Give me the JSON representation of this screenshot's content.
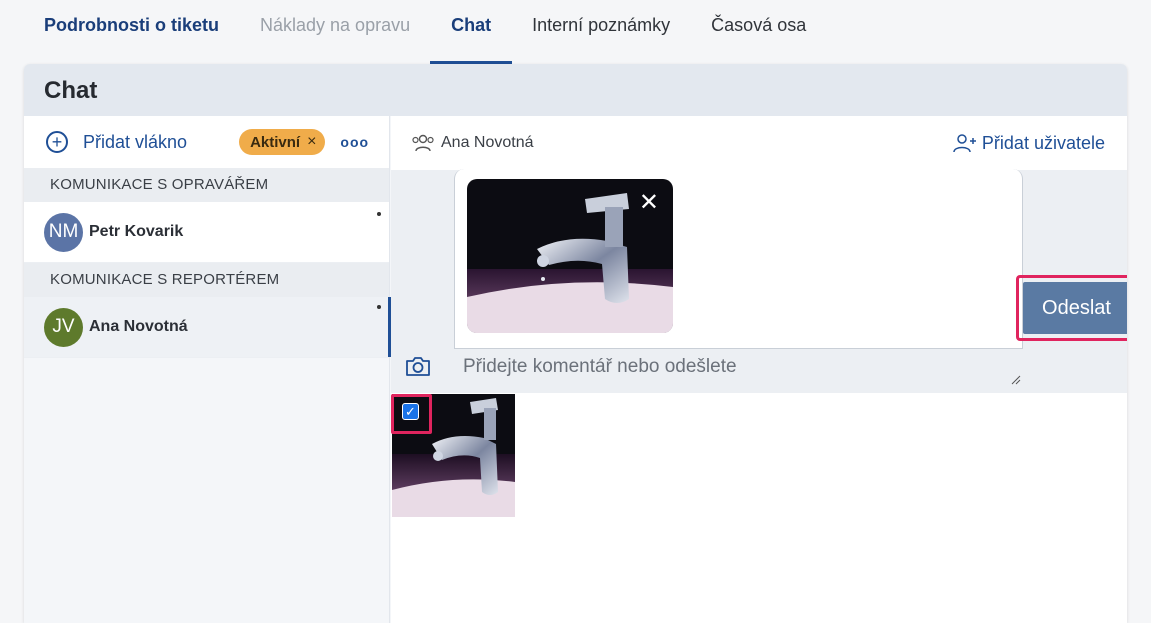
{
  "tabs": [
    {
      "label": "Podrobnosti o tiketu"
    },
    {
      "label": "Náklady na opravu"
    },
    {
      "label": "Chat"
    },
    {
      "label": "Interní poznámky"
    },
    {
      "label": "Časová osa"
    }
  ],
  "card": {
    "title": "Chat"
  },
  "left": {
    "add_thread_label": "Přidat vlákno",
    "plus_glyph": "+",
    "filter_badge": "Aktivní",
    "badge_close": "×",
    "more_glyph": "ooo",
    "groups": [
      {
        "title": "KOMUNIKACE S OPRAVÁŘEM",
        "threads": [
          {
            "initials": "NM",
            "name": "Petr Kovarik",
            "color": "#5b74a6"
          }
        ]
      },
      {
        "title": "KOMUNIKACE S REPORTÉREM",
        "threads": [
          {
            "initials": "JV",
            "name": "Ana Novotná",
            "color": "#5e7a2c"
          }
        ]
      }
    ]
  },
  "right": {
    "participants": "Ana Novotná",
    "add_user_label": "Přidat uživatele",
    "comment_placeholder": "Přidejte komentář nebo odešlete",
    "send_label": "Odeslat",
    "preview_close": "✕",
    "checkbox_glyph": "✓"
  },
  "colors": {
    "accent": "#1f4f96",
    "badge": "#f0ac4a",
    "highlight": "#e0245e",
    "send": "#5a7aa3"
  },
  "icons": [
    "plus-circle-icon",
    "close-icon",
    "more-icon",
    "users-icon",
    "add-user-icon",
    "camera-icon",
    "resize-grip-icon",
    "checkbox-checked-icon"
  ]
}
